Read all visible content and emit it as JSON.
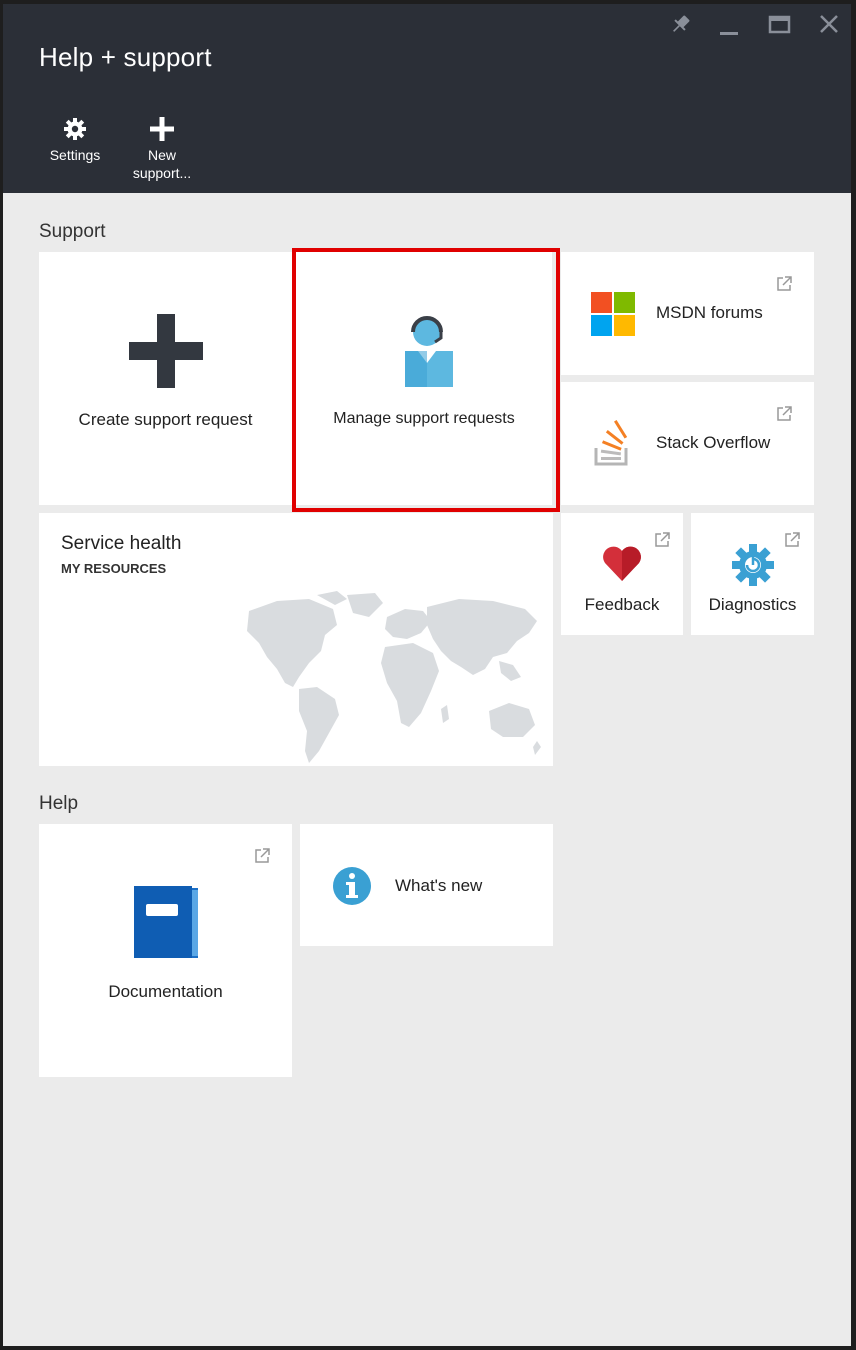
{
  "header": {
    "title": "Help + support",
    "tools": [
      {
        "label": "Settings",
        "icon": "gear-icon"
      },
      {
        "label": "New support...",
        "label_line1": "New",
        "label_line2": "support...",
        "icon": "plus-icon"
      }
    ],
    "window_controls": [
      "pin-icon",
      "minimize-icon",
      "maximize-icon",
      "close-icon"
    ]
  },
  "support": {
    "section_label": "Support",
    "create_label": "Create support request",
    "manage_label": "Manage support requests",
    "msdn_label": "MSDN forums",
    "stackoverflow_label": "Stack Overflow",
    "service_health_title": "Service health",
    "service_health_subtitle": "MY RESOURCES",
    "feedback_label": "Feedback",
    "diagnostics_label": "Diagnostics"
  },
  "help": {
    "section_label": "Help",
    "documentation_label": "Documentation",
    "whats_new_label": "What's new"
  },
  "colors": {
    "header_bg": "#2b2f37",
    "blade_bg": "#ebebeb",
    "highlight": "#e00000",
    "azure_blue": "#3aa0d3",
    "doc_blue": "#1b6fc6",
    "heart_red": "#d32f3a"
  }
}
